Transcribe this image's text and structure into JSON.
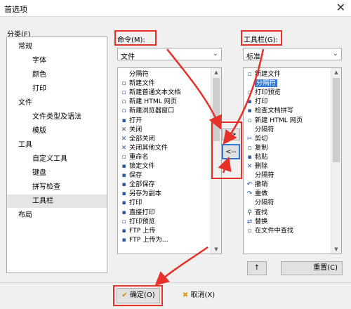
{
  "window": {
    "title": "首选项",
    "close_glyph": "✕"
  },
  "category": {
    "label": "分类(F)",
    "items": [
      {
        "label": "常规",
        "indent": 1
      },
      {
        "label": "字体",
        "indent": 2
      },
      {
        "label": "颜色",
        "indent": 2
      },
      {
        "label": "打印",
        "indent": 2
      },
      {
        "label": "文件",
        "indent": 1
      },
      {
        "label": "文件类型及语法",
        "indent": 2
      },
      {
        "label": "模版",
        "indent": 2
      },
      {
        "label": "工具",
        "indent": 1
      },
      {
        "label": "自定义工具",
        "indent": 2
      },
      {
        "label": "键盘",
        "indent": 2
      },
      {
        "label": "拼写检查",
        "indent": 2
      },
      {
        "label": "工具栏",
        "indent": 2,
        "selected": true
      },
      {
        "label": "布局",
        "indent": 1
      }
    ]
  },
  "commands": {
    "label": "命令(M):",
    "combo_value": "文件",
    "items": [
      {
        "label": "分隔符",
        "icon": ""
      },
      {
        "label": "新建文件",
        "icon": "▫"
      },
      {
        "label": "新建普通文本文档",
        "icon": "▫"
      },
      {
        "label": "新建 HTML 网页",
        "icon": "▫"
      },
      {
        "label": "新建浏览器窗口",
        "icon": "▫"
      },
      {
        "label": "打开",
        "icon": "▪"
      },
      {
        "label": "关闭",
        "icon": "✕"
      },
      {
        "label": "全部关闭",
        "icon": "✕"
      },
      {
        "label": "关闭其他文件",
        "icon": "✕"
      },
      {
        "label": "重命名",
        "icon": "▫"
      },
      {
        "label": "锁定文件",
        "icon": "▪"
      },
      {
        "label": "保存",
        "icon": "▪"
      },
      {
        "label": "全部保存",
        "icon": "▪"
      },
      {
        "label": "另存为副本",
        "icon": "▪"
      },
      {
        "label": "打印",
        "icon": "▪"
      },
      {
        "label": "直接打印",
        "icon": "▪"
      },
      {
        "label": "打印预览",
        "icon": "▫"
      },
      {
        "label": "FTP 上传",
        "icon": "▪"
      },
      {
        "label": "FTP 上传为...",
        "icon": "▪"
      }
    ]
  },
  "toolbar": {
    "label": "工具栏(G):",
    "combo_value": "标准",
    "items": [
      {
        "label": "新建文件",
        "icon": "▫"
      },
      {
        "label": "分隔符",
        "icon": "",
        "selected": true
      },
      {
        "label": "打印预览",
        "icon": "▫"
      },
      {
        "label": "打印",
        "icon": "▪"
      },
      {
        "label": "检查文档拼写",
        "icon": "▪"
      },
      {
        "label": "新建 HTML 网页",
        "icon": "▫"
      },
      {
        "label": "分隔符",
        "icon": ""
      },
      {
        "label": "剪切",
        "icon": "✂"
      },
      {
        "label": "复制",
        "icon": "▫"
      },
      {
        "label": "粘贴",
        "icon": "▪"
      },
      {
        "label": "删除",
        "icon": "✕"
      },
      {
        "label": "分隔符",
        "icon": ""
      },
      {
        "label": "撤销",
        "icon": "↶"
      },
      {
        "label": "重做",
        "icon": "↷"
      },
      {
        "label": "分隔符",
        "icon": ""
      },
      {
        "label": "查找",
        "icon": "⚲"
      },
      {
        "label": "替换",
        "icon": "⇄"
      },
      {
        "label": "在文件中查找",
        "icon": "▫"
      }
    ]
  },
  "buttons": {
    "add": "-->",
    "remove": "<--",
    "move_up": "↑",
    "reset": "重置(C)",
    "ok": "确定(O)",
    "cancel": "取消(X)",
    "ok_icon": "✔",
    "cancel_icon": "✖"
  },
  "colors": {
    "highlight": "#e8302a",
    "selection": "#3178d4"
  }
}
